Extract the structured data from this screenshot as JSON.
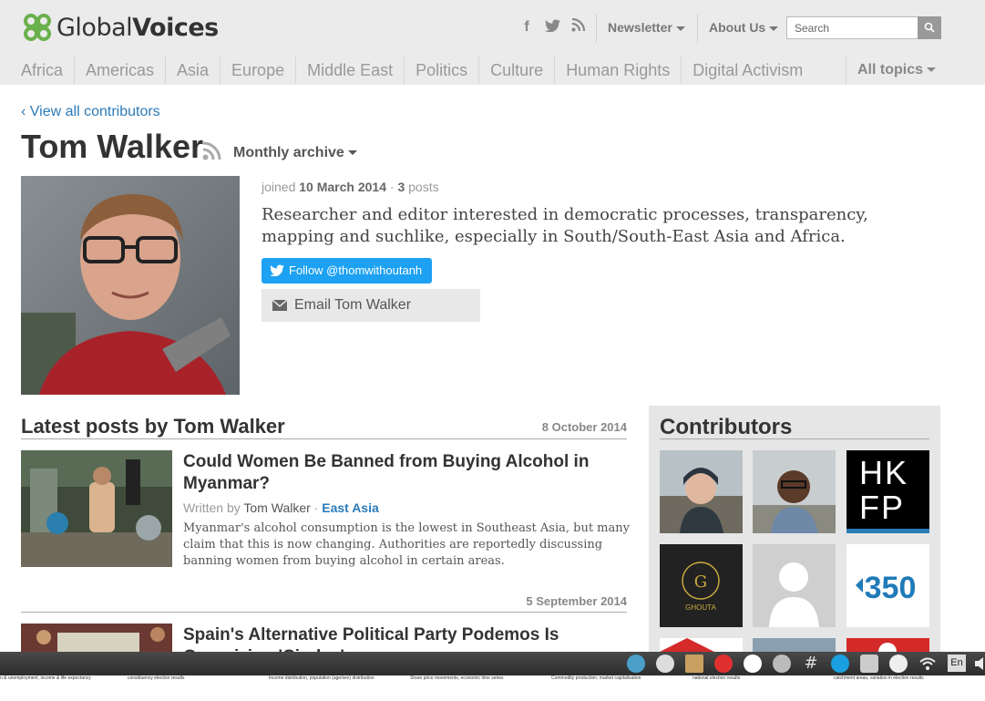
{
  "header": {
    "logo_text_light": "Global",
    "logo_text_bold": "Voices",
    "social_icons": [
      "facebook-icon",
      "twitter-icon",
      "rss-icon"
    ],
    "newsletter": "Newsletter",
    "about": "About Us",
    "search_placeholder": "Search",
    "nav": [
      "Africa",
      "Americas",
      "Asia",
      "Europe",
      "Middle East",
      "Politics",
      "Culture",
      "Human Rights",
      "Digital Activism"
    ],
    "all_topics": "All topics"
  },
  "profile": {
    "back_link": "View all contributors",
    "name": "Tom Walker",
    "monthly_archive": "Monthly archive",
    "joined_label": "joined",
    "joined_date": "10 March 2014",
    "posts_count": "3",
    "posts_label": "posts",
    "bio": "Researcher and editor interested in democratic processes, transparency, mapping and suchlike, especially in South/South-East Asia and Africa.",
    "twitter_button": "Follow @thomwithoutanh",
    "email_button": "Email Tom Walker"
  },
  "latest": {
    "title": "Latest posts by Tom Walker",
    "posts": [
      {
        "date": "8 October 2014",
        "title": "Could Women Be Banned from Buying Alcohol in Myanmar?",
        "written_by": "Written by",
        "author": "Tom Walker",
        "separator": "·",
        "category": "East Asia",
        "excerpt": "Myanmar's alcohol consumption is the lowest in Southeast Asia, but many claim that this is now changing. Authorities are reportedly discussing banning women from buying alcohol in certain areas."
      },
      {
        "date": "5 September 2014",
        "title": "Spain's Alternative Political Party Podemos Is Organizing 'Circles'"
      }
    ]
  },
  "sidebar": {
    "title": "Contributors",
    "tiles": [
      "contributor-woman-hat",
      "contributor-man-smiling",
      "HK FP",
      "Ghouta",
      "placeholder-avatar",
      "350"
    ]
  },
  "taskbar": {
    "lang": "En"
  },
  "below_strip": [
    "n & unemployment, income & life expectancy",
    "constituency election results",
    "Income distribution, population (age/sex) distribution",
    "Share price movements, economic time series",
    "Commodity production, market capitalisation",
    "national election results",
    "catchment areas, variation in election results"
  ]
}
